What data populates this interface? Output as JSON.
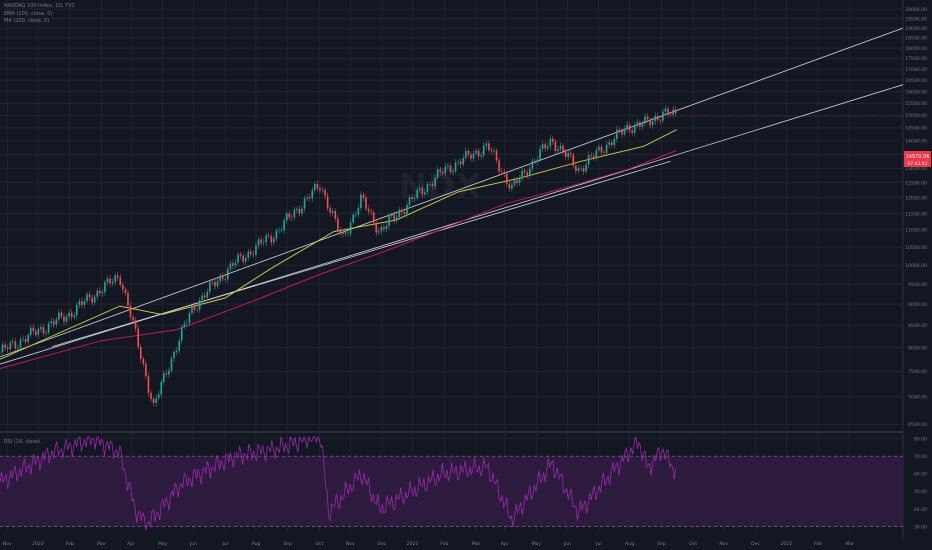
{
  "header": {
    "symbol_line": "NASDAQ 100 Index, 1D, TVC",
    "ma1_line": "EMA (100, close, 0)",
    "ma2_line": "MA (200, close, 0)",
    "rsi_line": "RSI (14, close)",
    "watermark": "NDX"
  },
  "price_badge": {
    "value": "14970.06",
    "countdown": "07:42:42"
  },
  "colors": {
    "background": "#131722",
    "grid": "#2a2e39",
    "axis_text": "#787b86",
    "candle_up": "#26a69a",
    "candle_down": "#ef5350",
    "ma1": "#c8c83c",
    "ma2": "#c2185b",
    "trendline": "#d1d4dc",
    "rsi_line": "#9c27b0",
    "rsi_band": "#2d1b3d",
    "price_badge": "#f23645"
  },
  "chart_data": [
    {
      "type": "candlestick",
      "title": "NASDAQ 100 Index, 1D, TVC",
      "y_scale": "log",
      "ylim": [
        6400,
        20500
      ],
      "y_ticks": [
        "6500.00",
        "7000.00",
        "7500.00",
        "8000.00",
        "8500.00",
        "9000.00",
        "9500.00",
        "10000.00",
        "10500.00",
        "11000.00",
        "11500.00",
        "12000.00",
        "12500.00",
        "13000.00",
        "13500.00",
        "14000.00",
        "14500.00",
        "15000.00",
        "15500.00",
        "16000.00",
        "16500.00",
        "17000.00",
        "17500.00",
        "18000.00",
        "18500.00",
        "19000.00",
        "19500.00",
        "20000.00"
      ],
      "x_ticks": [
        "Nov",
        "2020",
        "Feb",
        "Mar",
        "Apr",
        "May",
        "Jun",
        "Jul",
        "Aug",
        "Sep",
        "Oct",
        "Nov",
        "Dec",
        "2021",
        "Feb",
        "Mar",
        "Apr",
        "May",
        "Jun",
        "Jul",
        "Aug",
        "Sep",
        "Oct",
        "Nov",
        "Dec",
        "2022",
        "Feb",
        "Mar"
      ],
      "price_path": [
        [
          "2019-10-25",
          7900
        ],
        [
          "2019-12-31",
          8750
        ],
        [
          "2020-02-19",
          9718
        ],
        [
          "2020-03-09",
          7950
        ],
        [
          "2020-03-23",
          6800
        ],
        [
          "2020-04-30",
          8900
        ],
        [
          "2020-06-08",
          10000
        ],
        [
          "2020-07-20",
          10900
        ],
        [
          "2020-09-02",
          12420
        ],
        [
          "2020-09-23",
          10700
        ],
        [
          "2020-10-12",
          11950
        ],
        [
          "2020-10-30",
          10950
        ],
        [
          "2020-12-31",
          12900
        ],
        [
          "2021-02-12",
          13800
        ],
        [
          "2021-03-08",
          12300
        ],
        [
          "2021-04-16",
          14040
        ],
        [
          "2021-05-12",
          12950
        ],
        [
          "2021-06-30",
          14550
        ],
        [
          "2021-07-19",
          14700
        ],
        [
          "2021-08-02",
          15100
        ],
        [
          "2021-08-16",
          14970
        ]
      ],
      "series": [
        {
          "name": "EMA (100, close, 0)",
          "values": [
            [
              "2019-10-25",
              7750
            ],
            [
              "2020-02-19",
              8950
            ],
            [
              "2020-03-31",
              8750
            ],
            [
              "2020-06-01",
              9150
            ],
            [
              "2020-07-15",
              9900
            ],
            [
              "2020-09-15",
              10950
            ],
            [
              "2020-11-15",
              11300
            ],
            [
              "2021-01-15",
              12200
            ],
            [
              "2021-03-15",
              12650
            ],
            [
              "2021-05-15",
              13250
            ],
            [
              "2021-07-15",
              13800
            ],
            [
              "2021-08-16",
              14430
            ]
          ]
        },
        {
          "name": "MA (200, close, 0)",
          "values": [
            [
              "2019-10-25",
              7560
            ],
            [
              "2020-02-01",
              8150
            ],
            [
              "2020-04-15",
              8400
            ],
            [
              "2020-07-01",
              9100
            ],
            [
              "2020-09-01",
              9750
            ],
            [
              "2020-11-01",
              10350
            ],
            [
              "2021-01-01",
              11050
            ],
            [
              "2021-03-01",
              11800
            ],
            [
              "2021-05-01",
              12350
            ],
            [
              "2021-07-01",
              12980
            ],
            [
              "2021-08-16",
              13640
            ]
          ]
        }
      ],
      "trendlines": [
        {
          "from": [
            "2019-10-25",
            7800
          ],
          "to": [
            "2022-03-25",
            19000
          ]
        },
        {
          "from": [
            "2019-10-25",
            7650
          ],
          "to": [
            "2022-03-25",
            16300
          ]
        },
        {
          "from": [
            "2019-12-15",
            8020
          ],
          "to": [
            "2021-08-10",
            13250
          ]
        }
      ],
      "last_price": 14970.06
    },
    {
      "type": "line",
      "title": "RSI (14, close)",
      "ylim": [
        27,
        82
      ],
      "y_ticks": [
        "30.00",
        "40.00",
        "50.00",
        "60.00",
        "70.00",
        "80.00"
      ],
      "band": [
        30,
        70
      ],
      "path": [
        [
          "2019-10-25",
          55
        ],
        [
          "2019-12-15",
          72
        ],
        [
          "2020-01-24",
          80
        ],
        [
          "2020-02-19",
          72
        ],
        [
          "2020-03-05",
          40
        ],
        [
          "2020-03-16",
          31
        ],
        [
          "2020-03-27",
          38
        ],
        [
          "2020-04-20",
          55
        ],
        [
          "2020-06-10",
          70
        ],
        [
          "2020-07-20",
          74
        ],
        [
          "2020-09-02",
          82
        ],
        [
          "2020-09-10",
          38
        ],
        [
          "2020-10-12",
          60
        ],
        [
          "2020-10-30",
          40
        ],
        [
          "2020-12-31",
          60
        ],
        [
          "2021-02-12",
          64
        ],
        [
          "2021-03-08",
          34
        ],
        [
          "2021-04-16",
          66
        ],
        [
          "2021-05-12",
          38
        ],
        [
          "2021-06-30",
          72
        ],
        [
          "2021-07-10",
          78
        ],
        [
          "2021-07-19",
          63
        ],
        [
          "2021-08-02",
          74
        ],
        [
          "2021-08-16",
          60
        ]
      ]
    }
  ]
}
